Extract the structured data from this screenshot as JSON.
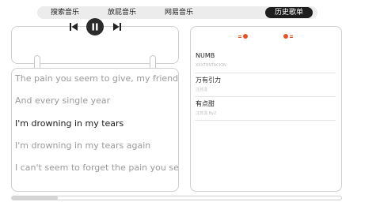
{
  "nav": {
    "items": [
      {
        "label": "搜索音乐"
      },
      {
        "label": "放屁音乐"
      },
      {
        "label": "网易音乐"
      },
      {
        "label": "历史歌单"
      }
    ],
    "active_index": 3
  },
  "player": {
    "controls": [
      "previous-icon",
      "pause-icon",
      "next-icon"
    ]
  },
  "lyrics": {
    "lines": [
      "The pain you seem to give, my friend",
      "And every single year",
      "I'm drowning in my tears",
      "I'm drowning in my tears again",
      "I can't seem to forget the pain you seem"
    ],
    "current_index": 2
  },
  "history": {
    "header_icons": [
      "tomato-icon",
      "tomato-icon"
    ],
    "songs": [
      {
        "title": "NUMB",
        "artist": "XXXTENTACION"
      },
      {
        "title": "万有引力",
        "artist": "汪苏泷"
      },
      {
        "title": "有点甜",
        "artist": "汪苏泷,By2"
      }
    ]
  },
  "playback": {
    "progress_fraction": 0.14
  },
  "colors": {
    "accent": "#e0542a",
    "active_tab_bg": "#1e1e1e",
    "border": "#cfcfcf"
  }
}
